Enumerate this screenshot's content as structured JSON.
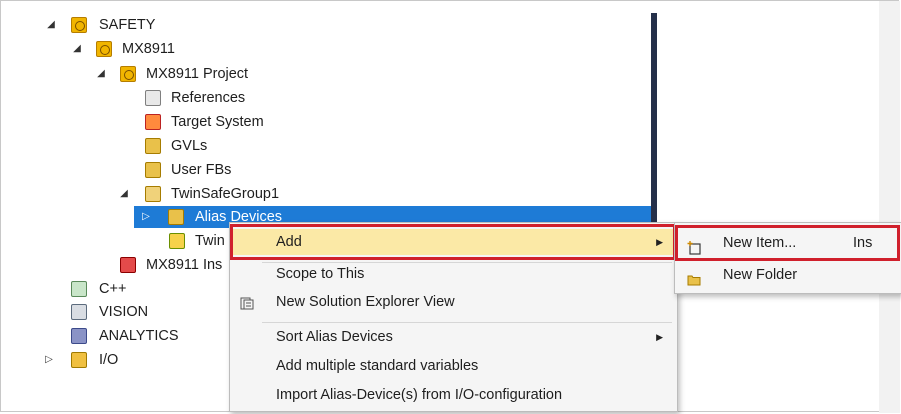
{
  "tree": {
    "items": [
      {
        "label": "SAFETY",
        "icon": "safety-icon",
        "arrow": "◢"
      },
      {
        "label": "MX8911",
        "icon": "safety-icon",
        "arrow": "◢"
      },
      {
        "label": "MX8911 Project",
        "icon": "safety-project-icon",
        "arrow": "◢"
      },
      {
        "label": "References",
        "icon": "references-icon",
        "arrow": ""
      },
      {
        "label": "Target System",
        "icon": "target-system-icon",
        "arrow": ""
      },
      {
        "label": "GVLs",
        "icon": "folder-icon",
        "arrow": ""
      },
      {
        "label": "User FBs",
        "icon": "folder-icon",
        "arrow": ""
      },
      {
        "label": "TwinSafeGroup1",
        "icon": "open-folder-icon",
        "arrow": "◢"
      },
      {
        "label": "Alias Devices",
        "icon": "folder-icon",
        "arrow": "▷"
      },
      {
        "label": "Twin",
        "icon": "twinsafe-icon",
        "arrow": ""
      },
      {
        "label": "MX8911 Ins",
        "icon": "instance-icon",
        "arrow": ""
      },
      {
        "label": "C++",
        "icon": "cpp-icon",
        "arrow": ""
      },
      {
        "label": "VISION",
        "icon": "vision-icon",
        "arrow": ""
      },
      {
        "label": "ANALYTICS",
        "icon": "analytics-icon",
        "arrow": ""
      },
      {
        "label": "I/O",
        "icon": "io-icon",
        "arrow": "▷"
      }
    ]
  },
  "context_menu": {
    "items": [
      {
        "label": "Add",
        "has_submenu": true
      },
      {
        "label": "Scope to This"
      },
      {
        "label": "New Solution Explorer View",
        "icon": "new-explorer-view-icon"
      },
      {
        "label": "Sort Alias Devices",
        "has_submenu": true
      },
      {
        "label": "Add multiple standard variables"
      },
      {
        "label": "Import Alias-Device(s) from I/O-configuration"
      }
    ],
    "submenu_glyph": "▶"
  },
  "submenu": {
    "items": [
      {
        "label": "New Item...",
        "shortcut": "Ins",
        "icon": "new-item-icon"
      },
      {
        "label": "New Folder",
        "icon": "new-folder-icon"
      }
    ]
  },
  "colors": {
    "selection": "#1e7bd6",
    "highlight_border": "#d0202c",
    "menu_hover": "#fbe9a6",
    "splitter": "#25304a"
  }
}
